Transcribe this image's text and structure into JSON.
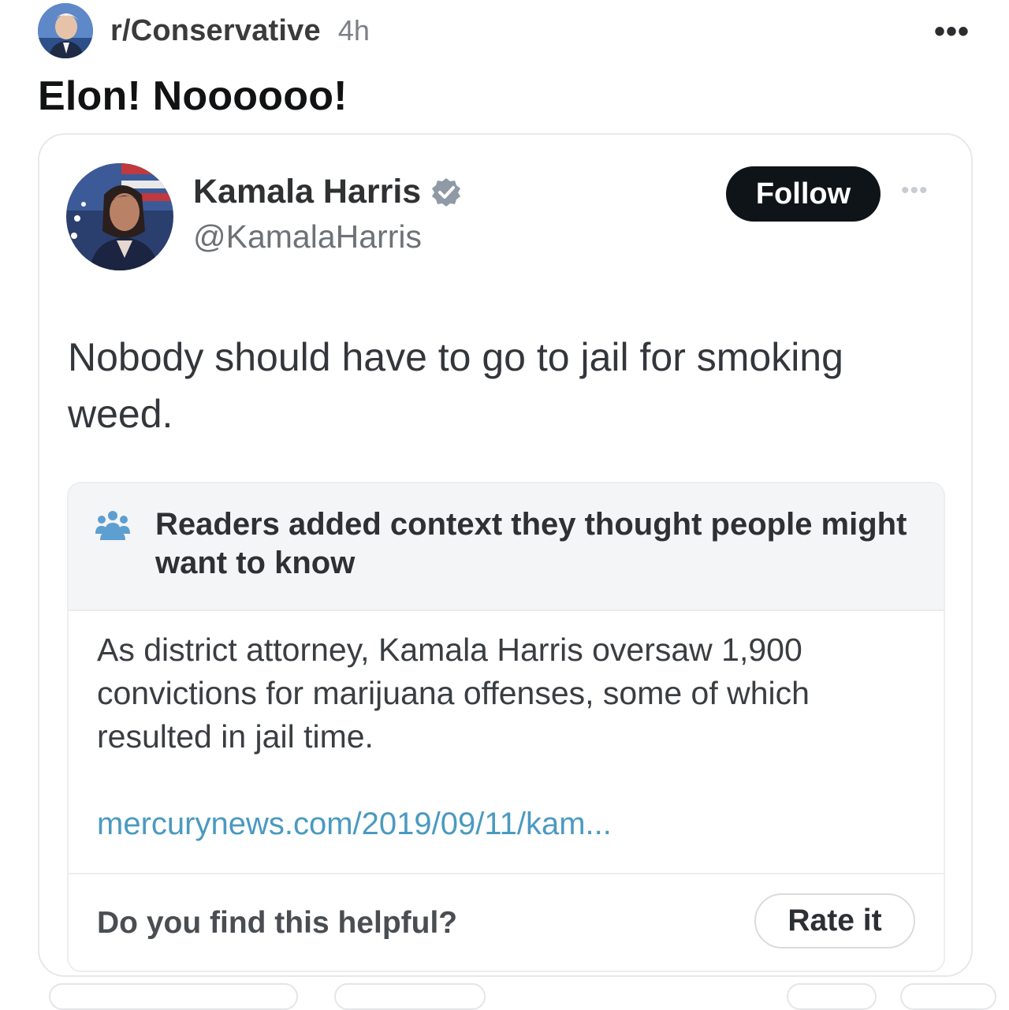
{
  "post": {
    "subreddit": "r/Conservative",
    "age": "4h",
    "more_icon": "more-horizontal-icon",
    "title": "Elon! Noooooo!"
  },
  "tweet": {
    "name": "Kamala Harris",
    "handle": "@KamalaHarris",
    "verified_icon": "verified-badge-icon",
    "follow_label": "Follow",
    "more_icon": "more-horizontal-icon",
    "text": "Nobody should have to go to jail for smoking weed."
  },
  "community_note": {
    "icon": "people-icon",
    "title": "Readers added context they thought people might want to know",
    "body": "As district attorney, Kamala Harris oversaw 1,900 convictions for marijuana offenses, some of which resulted in jail time.",
    "link": "mercurynews.com/2019/09/11/kam...",
    "helpful_question": "Do you find this helpful?",
    "rate_label": "Rate it"
  },
  "colors": {
    "follow_bg": "#0f1419",
    "link": "#4a9ac0",
    "note_header_bg": "#f4f5f6",
    "verified_badge": "#8f9aa6"
  }
}
